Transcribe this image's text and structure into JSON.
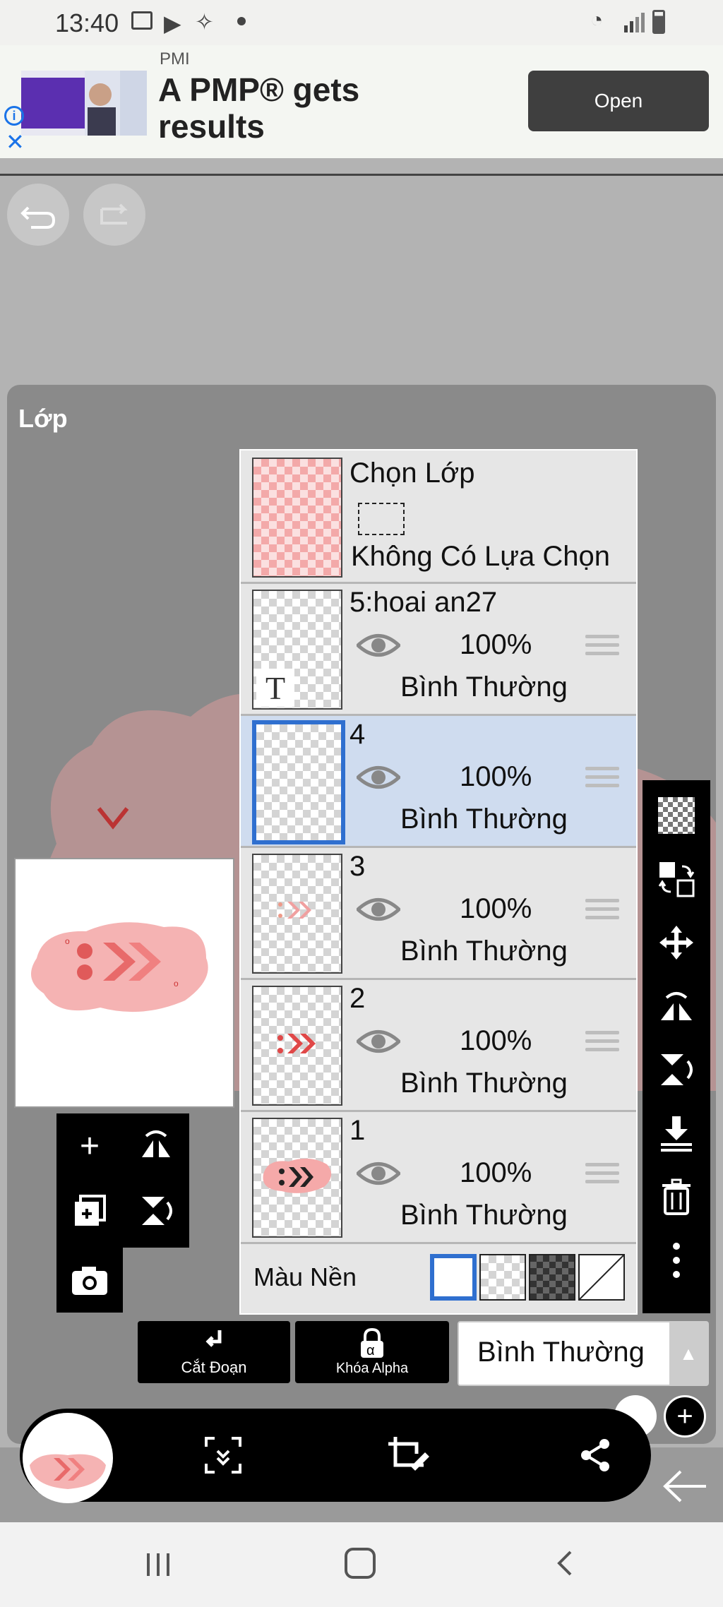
{
  "status_bar": {
    "time": "13:40"
  },
  "ad": {
    "brand": "PMI",
    "headline_line1": "A PMP® gets",
    "headline_line2": "results",
    "open_label": "Open"
  },
  "panel": {
    "title": "Lớp"
  },
  "select_layer": {
    "title": "Chọn Lớp",
    "status": "Không Có Lựa Chọn"
  },
  "layers": [
    {
      "name": "5:hoai an27",
      "opacity": "100%",
      "mode": "Bình Thường"
    },
    {
      "name": "4",
      "opacity": "100%",
      "mode": "Bình Thường"
    },
    {
      "name": "3",
      "opacity": "100%",
      "mode": "Bình Thường"
    },
    {
      "name": "2",
      "opacity": "100%",
      "mode": "Bình Thường"
    },
    {
      "name": "1",
      "opacity": "100%",
      "mode": "Bình Thường"
    }
  ],
  "background": {
    "label": "Màu Nền"
  },
  "buttons": {
    "clipping": "Cắt Đoạn",
    "alpha_lock": "Khóa Alpha",
    "blend_mode": "Bình Thường"
  },
  "colors": {
    "selected_row": "#cfdcef",
    "accent_blue": "#2f6fcf",
    "pink": "#f5a9a9",
    "red": "#e04848"
  }
}
